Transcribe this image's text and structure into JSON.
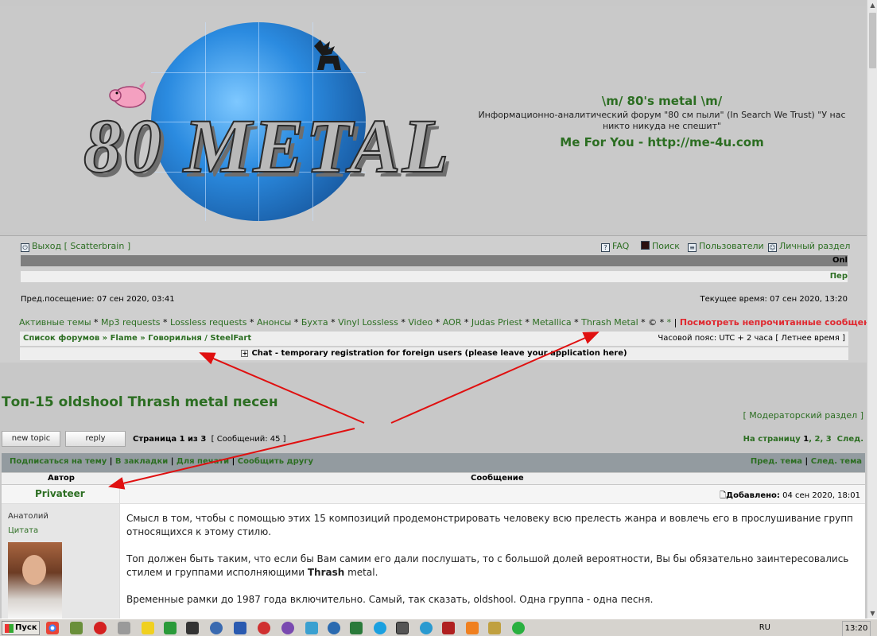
{
  "header": {
    "logo_text": "80 METAL",
    "site_title": "\\m/ 80's metal \\m/",
    "site_desc": "Информационно-аналитический форум \"80 см пыли\" (In Search We Trust) \"У нас никто никуда не спешит\"",
    "site_link": "Me For You - http://me-4u.com"
  },
  "nav": {
    "logout": "Выход [ Scatterbrain ]",
    "faq": "FAQ",
    "search": "Поиск",
    "users": "Пользователи",
    "profile": "Личный раздел",
    "dark_bar_text": "Onl",
    "light_bar_text": "Пер"
  },
  "visits": {
    "last_visit": "Пред.посещение: 07 сен 2020, 03:41",
    "current_time": "Текущее время: 07 сен 2020, 13:20"
  },
  "quicklinks": {
    "items": [
      "Активные темы",
      "Mp3 requests",
      "Lossless requests",
      "Анонсы",
      "Бухта",
      "Vinyl Lossless",
      "Video",
      "AOR",
      "Judas Priest",
      "Metallica",
      "Thrash Metal",
      "©",
      "*"
    ],
    "unread": "Посмотреть непрочитанные сообщения"
  },
  "breadcrumbs": {
    "path": "Список форумов » Flame » Говорильня / SteelFart",
    "timezone": "Часовой пояс: UTC + 2 часа [ Летнее время ]"
  },
  "chat": {
    "label": "Chat - temporary registration for foreign users (please leave your application here)"
  },
  "topic": {
    "title": "Топ-15 oldshool Thrash metal песен",
    "moderator_link": "[ Модераторский раздел ]",
    "new_topic_label": "new topic",
    "reply_label": "reply",
    "page_label": "Страница 1 из 3",
    "messages_count": "[ Сообщений: 45 ]",
    "goto_label": "На страницу",
    "pages": [
      "1",
      "2",
      "3"
    ],
    "next_label": "След."
  },
  "actions": {
    "subscribe": "Подписаться на тему",
    "bookmark": "В закладки",
    "print": "Для печати",
    "tell_friend": "Сообщить другу",
    "prev_topic": "Пред. тема",
    "next_topic": "След. тема"
  },
  "columns": {
    "author": "Автор",
    "message": "Сообщение"
  },
  "post": {
    "author": "Privateer",
    "posted_label": "Добавлено:",
    "posted_date": "04 сен 2020, 18:01",
    "author_name": "Анатолий",
    "quote": "Цитата",
    "paragraphs": [
      "Смысл в том, чтобы с помощью этих 15 композиций продемонстрировать человеку всю прелесть жанра и вовлечь его в прослушивание групп относящихся к этому стилю.",
      "Топ должен быть таким, что если бы Вам самим его дали послушать, то с большой долей вероятности, Вы бы обязательно заинтересовались стилем и группами исполняющими",
      "Временные рамки до 1987 года включительно. Самый, так сказать, oldshool. Одна группа - одна песня."
    ],
    "bold_word": "Thrash",
    "tail": " metal."
  },
  "taskbar": {
    "start": "Пуск",
    "lang": "RU",
    "clock": "13:20"
  },
  "colors": {
    "link_green": "#2c6e22",
    "unread_red": "#e0282f",
    "arrow_red": "#e01010"
  }
}
